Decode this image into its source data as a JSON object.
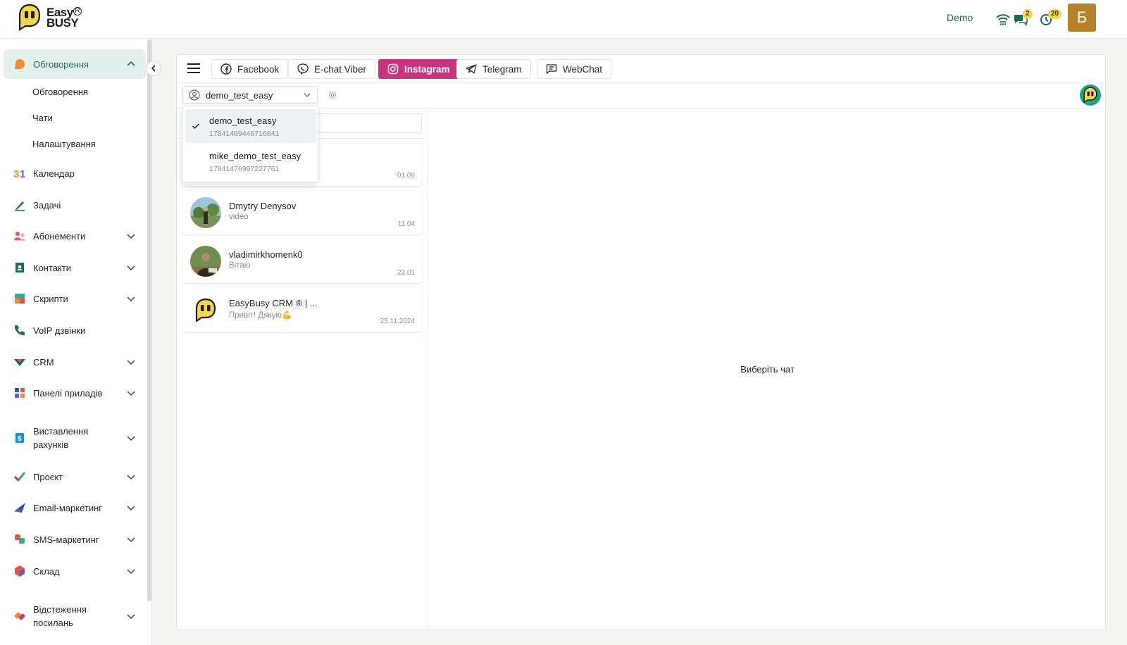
{
  "header": {
    "brand": "Easy BUSY",
    "brand_line1": "Easy",
    "brand_line2": "BUSY",
    "demo_link": "Demo",
    "chat_badge": "2",
    "timer_badge": "20",
    "avatar_letter": "Б",
    "accent": "#1d6b5c",
    "avatar_color": "#b7812a"
  },
  "sidebar": {
    "active": {
      "label": "Обговорення",
      "icon": "chat-bubble-icon"
    },
    "sub_items": [
      "Обговорення",
      "Чати",
      "Налаштування"
    ],
    "items": [
      {
        "label": "Календар",
        "icon": "calendar-icon",
        "expandable": false
      },
      {
        "label": "Задачі",
        "icon": "pen-icon",
        "expandable": false
      },
      {
        "label": "Абонементи",
        "icon": "users-icon",
        "expandable": true
      },
      {
        "label": "Контакти",
        "icon": "contact-book-icon",
        "expandable": true
      },
      {
        "label": "Скрипти",
        "icon": "script-icon",
        "expandable": true
      },
      {
        "label": "VoIP дзвінки",
        "icon": "phone-icon",
        "expandable": false
      },
      {
        "label": "CRM",
        "icon": "crm-icon",
        "expandable": true
      },
      {
        "label": "Панелі приладів",
        "icon": "dashboard-icon",
        "expandable": true
      },
      {
        "label": "Виставлення рахунків",
        "icon": "invoice-icon",
        "expandable": true
      },
      {
        "label": "Проєкт",
        "icon": "check-icon",
        "expandable": true
      },
      {
        "label": "Email-маркетинг",
        "icon": "paper-plane-icon",
        "expandable": true
      },
      {
        "label": "SMS-маркетинг",
        "icon": "sms-icon",
        "expandable": true
      },
      {
        "label": "Склад",
        "icon": "box-icon",
        "expandable": true
      },
      {
        "label": "Відстеження посилань",
        "icon": "link-icon",
        "expandable": true
      }
    ]
  },
  "channels": {
    "tabs": [
      {
        "label": "Facebook",
        "icon": "facebook-icon"
      },
      {
        "label": "E-chat Viber",
        "icon": "viber-icon"
      },
      {
        "label": "Instagram",
        "icon": "instagram-icon",
        "active": true
      },
      {
        "label": "Telegram",
        "icon": "telegram-icon"
      },
      {
        "label": "WebChat",
        "icon": "webchat-icon"
      }
    ],
    "active_color": "#c8327f"
  },
  "account": {
    "selected": "demo_test_easy",
    "options": [
      {
        "name": "demo_test_easy",
        "id": "17841469446716841",
        "selected": true
      },
      {
        "name": "mike_demo_test_easy",
        "id": "17841476997227761",
        "selected": false
      }
    ]
  },
  "chats": [
    {
      "name": "",
      "message": "",
      "time": "01.09"
    },
    {
      "name": "Dmytry Denysov",
      "message": "video",
      "time": "11.04"
    },
    {
      "name": "vladimirkhomenk0",
      "message": "Вітаю",
      "time": "23.01"
    },
    {
      "name": "EasyBusy CRM ® | ...",
      "message": "Привіт! Дякую💪",
      "time": "25.11.2024"
    }
  ],
  "empty_state": "Виберіть чат"
}
